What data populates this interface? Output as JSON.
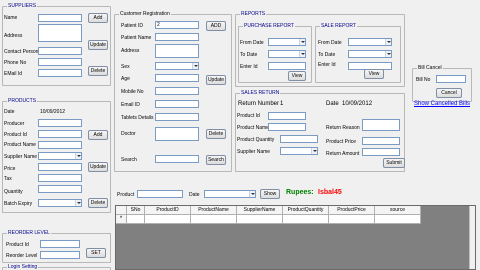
{
  "suppliers": {
    "title": "SUPPLIERS",
    "name_label": "Name",
    "address_label": "Address",
    "contact_person_label": "Contact Person",
    "phone_label": "Phone No",
    "email_label": "EMail Id",
    "add": "Add",
    "update": "Update",
    "delete": "Delete"
  },
  "customer": {
    "title": "Customer Registration",
    "patient_id_label": "Patient ID",
    "patient_id_value": "2",
    "patient_name_label": "Patient Name",
    "address_label": "Address",
    "sex_label": "Sex",
    "age_label": "Age",
    "mobile_label": "Mobile No",
    "email_label": "Email ID",
    "tablets_label": "Tablets Details",
    "doctor_label": "Doctor",
    "search_label": "Search",
    "add": "ADD",
    "update": "Update",
    "delete": "Delete",
    "search_btn": "Search"
  },
  "reports": {
    "title": "REPORTS",
    "purchase": {
      "title": "PURCHASE REPORT",
      "from_label": "From Date",
      "to_label": "To Date",
      "enter_label": "Enter Id",
      "view": "View"
    },
    "sale": {
      "title": "SALE REPORT",
      "from_label": "From Date",
      "to_label": "To Date",
      "enter_label": "Enter Id",
      "view": "View"
    }
  },
  "bill_cancel": {
    "title": "Bill Cancel",
    "bill_no_label": "Bill No",
    "cancel": "Cancel",
    "show_link": "Show Cancelled Bills"
  },
  "products": {
    "title": "PRODUCTS",
    "date_label": "Date",
    "date_value": "10/09/2012",
    "producer_label": "Producer",
    "product_id_label": "Product Id",
    "product_name_label": "Product Name",
    "supplier_name_label": "Supplier Name",
    "price_label": "Price",
    "tax_label": "Tax",
    "quantity_label": "Quantity",
    "batch_label": "Batch Expiry",
    "add": "Add",
    "update": "Update",
    "delete": "Delete"
  },
  "sales_return": {
    "title": "SALES RETURN",
    "return_number_label": "Return Number",
    "return_number_value": "1",
    "date_label": "Date",
    "date_value": "10/09/2012",
    "product_id_label": "Product Id",
    "product_name_label": "Product Name",
    "product_quantity_label": "Product Quantity",
    "supplier_name_label": "Supplier Name",
    "return_reason_label": "Return Reason",
    "product_price_label": "Product Price",
    "return_amount_label": "Return Amount",
    "submit": "Submit"
  },
  "filter": {
    "product_label": "Product",
    "date_label": "Date",
    "show": "Show",
    "rupees_label": "Rupees:",
    "rupees_value": "Isbal45"
  },
  "grid": {
    "columns": [
      "SNo",
      "ProductID",
      "ProductName",
      "SupplierName",
      "ProductQuantity",
      "ProductPrice",
      "source"
    ],
    "new_row_marker": "*"
  },
  "reorder": {
    "title": "REORDER LEVEL",
    "product_id_label": "Product Id",
    "reorder_label": "Reorder Level",
    "set": "SET"
  },
  "login": {
    "title": "Login Setting"
  },
  "colors": {
    "rupees_green": "#008000",
    "rupees_value_red": "#ff0000",
    "link_blue": "#0000ff",
    "group_title": "#00008b",
    "grid_bg": "#808080"
  }
}
